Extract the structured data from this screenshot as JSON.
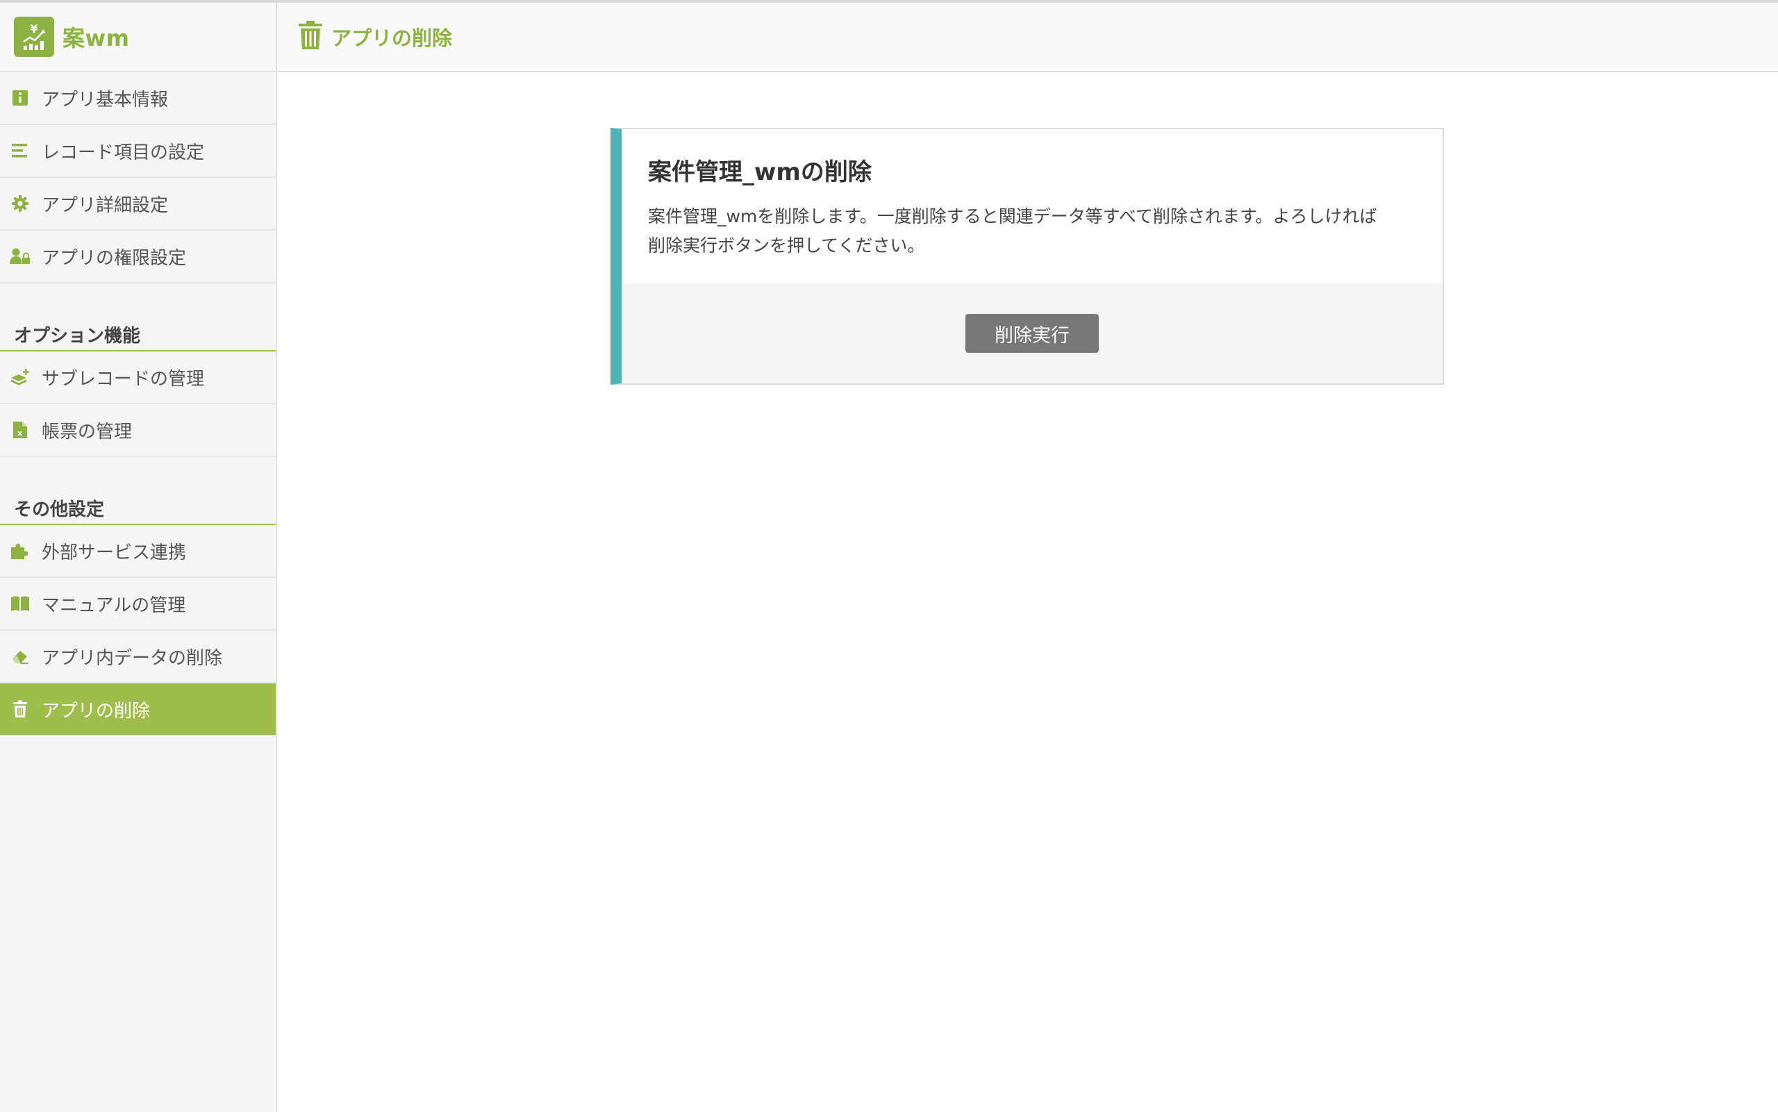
{
  "app": {
    "name": "案wm",
    "logo_icon": "yen-chart-icon",
    "accent_color": "#8eb241"
  },
  "sidebar": {
    "items": [
      {
        "label": "アプリ基本情報",
        "icon": "info-icon"
      },
      {
        "label": "レコード項目の設定",
        "icon": "list-icon"
      },
      {
        "label": "アプリ詳細設定",
        "icon": "gear-icon"
      },
      {
        "label": "アプリの権限設定",
        "icon": "user-lock-icon"
      }
    ],
    "sections": [
      {
        "title": "オプション機能",
        "items": [
          {
            "label": "サブレコードの管理",
            "icon": "layers-plus-icon"
          },
          {
            "label": "帳票の管理",
            "icon": "excel-file-icon"
          }
        ]
      },
      {
        "title": "その他設定",
        "items": [
          {
            "label": "外部サービス連携",
            "icon": "puzzle-icon"
          },
          {
            "label": "マニュアルの管理",
            "icon": "book-icon"
          },
          {
            "label": "アプリ内データの削除",
            "icon": "eraser-icon"
          },
          {
            "label": "アプリの削除",
            "icon": "trash-icon",
            "active": true
          }
        ]
      }
    ]
  },
  "header": {
    "title": "アプリの削除",
    "icon": "trash-icon"
  },
  "card": {
    "title": "案件管理_wmの削除",
    "text_line1": "案件管理_wmを削除します。一度削除すると関連データ等すべて削除されます。よろしければ",
    "text_line2": "削除実行ボタンを押してください。",
    "button_label": "削除実行",
    "accent_color": "#4fb4b6"
  }
}
